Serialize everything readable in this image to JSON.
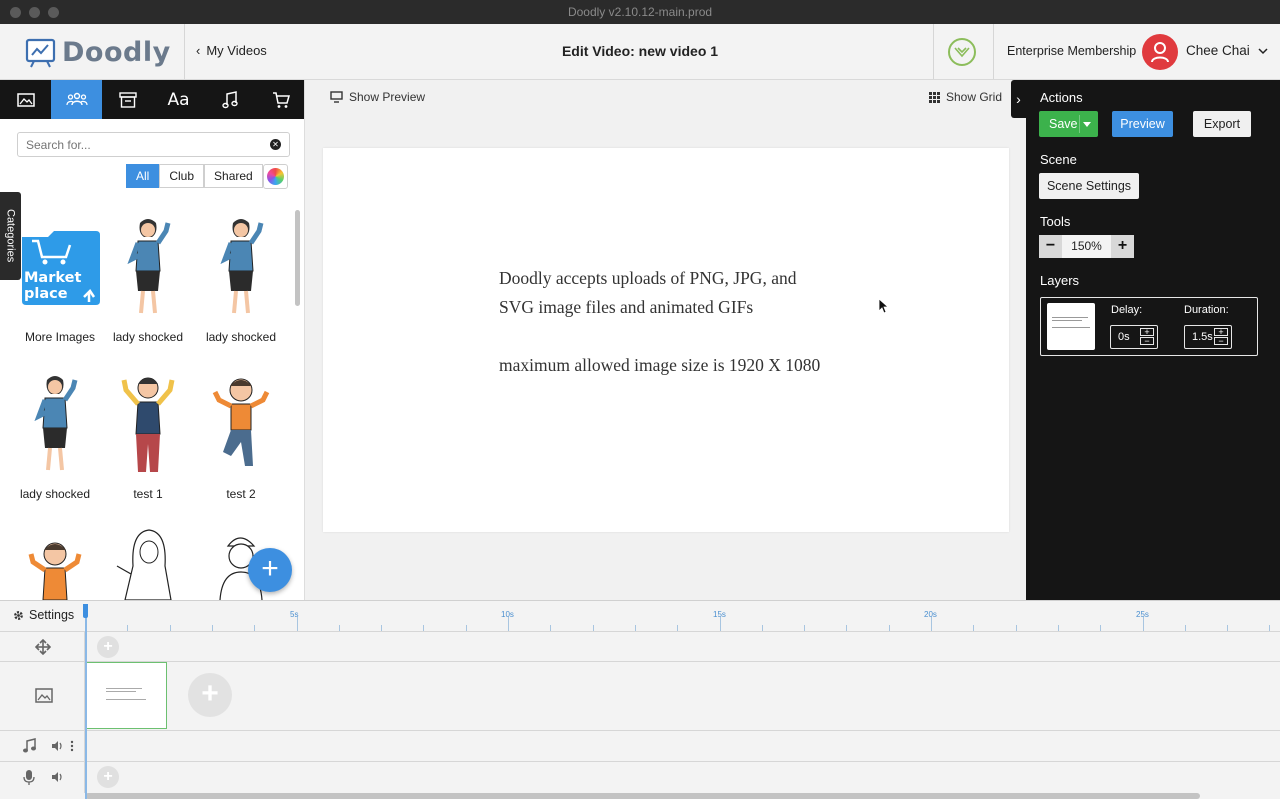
{
  "window": {
    "title": "Doodly v2.10.12-main.prod"
  },
  "header": {
    "logo_text": "Doodly",
    "back_label": "My Videos",
    "edit_title": "Edit Video: new video 1",
    "membership": "Enterprise Membership",
    "username": "Chee Chai"
  },
  "left_panel": {
    "tabs": [
      "images-tab",
      "characters-tab",
      "props-tab",
      "text-tab",
      "music-tab",
      "marketplace-tab"
    ],
    "active_tab": "characters-tab",
    "search_placeholder": "Search for...",
    "filters": [
      "All",
      "Club",
      "Shared"
    ],
    "active_filter": "All",
    "categories_label": "Categories",
    "marketplace_tile": {
      "line1": "Market",
      "line2": "place"
    },
    "items": [
      {
        "caption": "More Images"
      },
      {
        "caption": "lady shocked"
      },
      {
        "caption": "lady shocked"
      },
      {
        "caption": "lady shocked"
      },
      {
        "caption": "test 1"
      },
      {
        "caption": "test 2"
      }
    ]
  },
  "canvas": {
    "show_preview": "Show Preview",
    "show_grid": "Show Grid",
    "text_line1": "Doodly accepts uploads of PNG, JPG, and",
    "text_line2": "SVG image files and animated GIFs",
    "text_line3": "maximum allowed image size is 1920 X 1080"
  },
  "right_panel": {
    "actions_label": "Actions",
    "save_label": "Save",
    "preview_label": "Preview",
    "export_label": "Export",
    "scene_label": "Scene",
    "scene_settings_label": "Scene Settings",
    "tools_label": "Tools",
    "zoom_value": "150%",
    "layers_label": "Layers",
    "layer": {
      "delay_label": "Delay:",
      "delay_value": "0s",
      "duration_label": "Duration:",
      "duration_value": "1.5s"
    }
  },
  "timeline": {
    "settings_label": "Settings",
    "ruler_labels": [
      "5s",
      "10s",
      "15s",
      "20s",
      "25s"
    ]
  },
  "colors": {
    "accent_blue": "#3d8fe0",
    "save_green": "#3cb24c",
    "avatar_red": "#e03a3e",
    "panel_dark": "#151515"
  }
}
